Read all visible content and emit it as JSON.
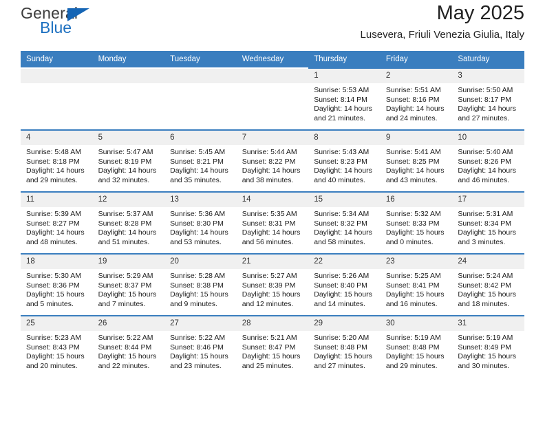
{
  "logo": {
    "line1": "General",
    "line2": "Blue",
    "triangle_icon": "blue-triangle-icon",
    "blue": "#1d70c0"
  },
  "header": {
    "title": "May 2025",
    "subtitle": "Lusevera, Friuli Venezia Giulia, Italy"
  },
  "colors": {
    "header_blue": "#3a7ebf",
    "daynum_background": "#f0f0f0"
  },
  "weekday_headers": [
    "Sunday",
    "Monday",
    "Tuesday",
    "Wednesday",
    "Thursday",
    "Friday",
    "Saturday"
  ],
  "labels": {
    "sunrise_prefix": "Sunrise:",
    "sunset_prefix": "Sunset:",
    "daylight_prefix": "Daylight:"
  },
  "weeks": [
    [
      {
        "day": "",
        "empty": true
      },
      {
        "day": "",
        "empty": true
      },
      {
        "day": "",
        "empty": true
      },
      {
        "day": "",
        "empty": true
      },
      {
        "day": "1",
        "sunrise": "Sunrise: 5:53 AM",
        "sunset": "Sunset: 8:14 PM",
        "daylight": "Daylight: 14 hours and 21 minutes."
      },
      {
        "day": "2",
        "sunrise": "Sunrise: 5:51 AM",
        "sunset": "Sunset: 8:16 PM",
        "daylight": "Daylight: 14 hours and 24 minutes."
      },
      {
        "day": "3",
        "sunrise": "Sunrise: 5:50 AM",
        "sunset": "Sunset: 8:17 PM",
        "daylight": "Daylight: 14 hours and 27 minutes."
      }
    ],
    [
      {
        "day": "4",
        "sunrise": "Sunrise: 5:48 AM",
        "sunset": "Sunset: 8:18 PM",
        "daylight": "Daylight: 14 hours and 29 minutes."
      },
      {
        "day": "5",
        "sunrise": "Sunrise: 5:47 AM",
        "sunset": "Sunset: 8:19 PM",
        "daylight": "Daylight: 14 hours and 32 minutes."
      },
      {
        "day": "6",
        "sunrise": "Sunrise: 5:45 AM",
        "sunset": "Sunset: 8:21 PM",
        "daylight": "Daylight: 14 hours and 35 minutes."
      },
      {
        "day": "7",
        "sunrise": "Sunrise: 5:44 AM",
        "sunset": "Sunset: 8:22 PM",
        "daylight": "Daylight: 14 hours and 38 minutes."
      },
      {
        "day": "8",
        "sunrise": "Sunrise: 5:43 AM",
        "sunset": "Sunset: 8:23 PM",
        "daylight": "Daylight: 14 hours and 40 minutes."
      },
      {
        "day": "9",
        "sunrise": "Sunrise: 5:41 AM",
        "sunset": "Sunset: 8:25 PM",
        "daylight": "Daylight: 14 hours and 43 minutes."
      },
      {
        "day": "10",
        "sunrise": "Sunrise: 5:40 AM",
        "sunset": "Sunset: 8:26 PM",
        "daylight": "Daylight: 14 hours and 46 minutes."
      }
    ],
    [
      {
        "day": "11",
        "sunrise": "Sunrise: 5:39 AM",
        "sunset": "Sunset: 8:27 PM",
        "daylight": "Daylight: 14 hours and 48 minutes."
      },
      {
        "day": "12",
        "sunrise": "Sunrise: 5:37 AM",
        "sunset": "Sunset: 8:28 PM",
        "daylight": "Daylight: 14 hours and 51 minutes."
      },
      {
        "day": "13",
        "sunrise": "Sunrise: 5:36 AM",
        "sunset": "Sunset: 8:30 PM",
        "daylight": "Daylight: 14 hours and 53 minutes."
      },
      {
        "day": "14",
        "sunrise": "Sunrise: 5:35 AM",
        "sunset": "Sunset: 8:31 PM",
        "daylight": "Daylight: 14 hours and 56 minutes."
      },
      {
        "day": "15",
        "sunrise": "Sunrise: 5:34 AM",
        "sunset": "Sunset: 8:32 PM",
        "daylight": "Daylight: 14 hours and 58 minutes."
      },
      {
        "day": "16",
        "sunrise": "Sunrise: 5:32 AM",
        "sunset": "Sunset: 8:33 PM",
        "daylight": "Daylight: 15 hours and 0 minutes."
      },
      {
        "day": "17",
        "sunrise": "Sunrise: 5:31 AM",
        "sunset": "Sunset: 8:34 PM",
        "daylight": "Daylight: 15 hours and 3 minutes."
      }
    ],
    [
      {
        "day": "18",
        "sunrise": "Sunrise: 5:30 AM",
        "sunset": "Sunset: 8:36 PM",
        "daylight": "Daylight: 15 hours and 5 minutes."
      },
      {
        "day": "19",
        "sunrise": "Sunrise: 5:29 AM",
        "sunset": "Sunset: 8:37 PM",
        "daylight": "Daylight: 15 hours and 7 minutes."
      },
      {
        "day": "20",
        "sunrise": "Sunrise: 5:28 AM",
        "sunset": "Sunset: 8:38 PM",
        "daylight": "Daylight: 15 hours and 9 minutes."
      },
      {
        "day": "21",
        "sunrise": "Sunrise: 5:27 AM",
        "sunset": "Sunset: 8:39 PM",
        "daylight": "Daylight: 15 hours and 12 minutes."
      },
      {
        "day": "22",
        "sunrise": "Sunrise: 5:26 AM",
        "sunset": "Sunset: 8:40 PM",
        "daylight": "Daylight: 15 hours and 14 minutes."
      },
      {
        "day": "23",
        "sunrise": "Sunrise: 5:25 AM",
        "sunset": "Sunset: 8:41 PM",
        "daylight": "Daylight: 15 hours and 16 minutes."
      },
      {
        "day": "24",
        "sunrise": "Sunrise: 5:24 AM",
        "sunset": "Sunset: 8:42 PM",
        "daylight": "Daylight: 15 hours and 18 minutes."
      }
    ],
    [
      {
        "day": "25",
        "sunrise": "Sunrise: 5:23 AM",
        "sunset": "Sunset: 8:43 PM",
        "daylight": "Daylight: 15 hours and 20 minutes."
      },
      {
        "day": "26",
        "sunrise": "Sunrise: 5:22 AM",
        "sunset": "Sunset: 8:44 PM",
        "daylight": "Daylight: 15 hours and 22 minutes."
      },
      {
        "day": "27",
        "sunrise": "Sunrise: 5:22 AM",
        "sunset": "Sunset: 8:46 PM",
        "daylight": "Daylight: 15 hours and 23 minutes."
      },
      {
        "day": "28",
        "sunrise": "Sunrise: 5:21 AM",
        "sunset": "Sunset: 8:47 PM",
        "daylight": "Daylight: 15 hours and 25 minutes."
      },
      {
        "day": "29",
        "sunrise": "Sunrise: 5:20 AM",
        "sunset": "Sunset: 8:48 PM",
        "daylight": "Daylight: 15 hours and 27 minutes."
      },
      {
        "day": "30",
        "sunrise": "Sunrise: 5:19 AM",
        "sunset": "Sunset: 8:48 PM",
        "daylight": "Daylight: 15 hours and 29 minutes."
      },
      {
        "day": "31",
        "sunrise": "Sunrise: 5:19 AM",
        "sunset": "Sunset: 8:49 PM",
        "daylight": "Daylight: 15 hours and 30 minutes."
      }
    ]
  ]
}
